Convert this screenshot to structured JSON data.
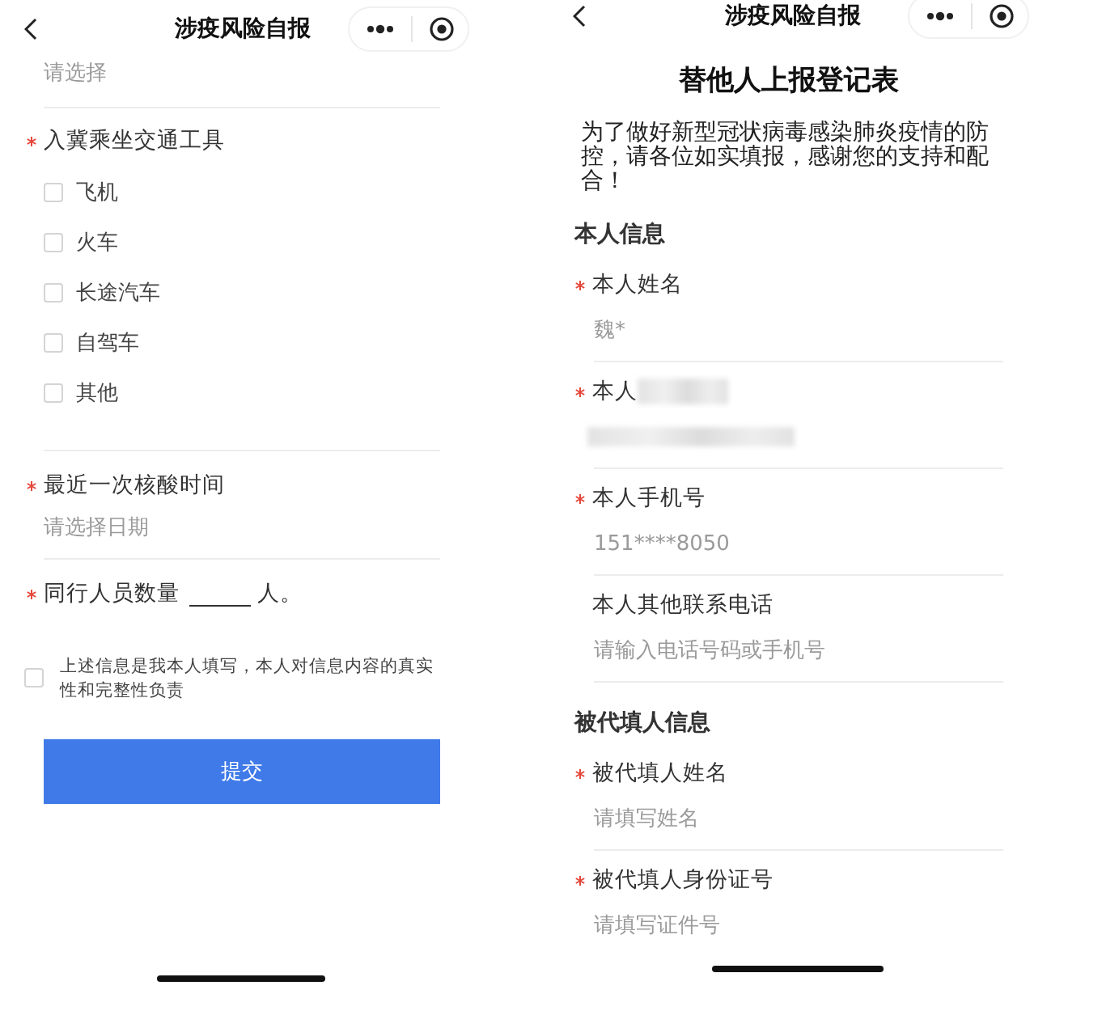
{
  "left_screen": {
    "nav": {
      "title": "涉疫风险自报"
    },
    "items": [
      {
        "kind": "select",
        "placeholder": "请选择"
      },
      {
        "kind": "checkbox_group",
        "label": "入冀乘坐交通工具",
        "required": true,
        "options": [
          {
            "label": "飞机",
            "checked": false
          },
          {
            "label": "火车",
            "checked": false
          },
          {
            "label": "长途汽车",
            "checked": false
          },
          {
            "label": "自驾车",
            "checked": false
          },
          {
            "label": "其他",
            "checked": false
          }
        ]
      },
      {
        "kind": "date",
        "label": "最近一次核酸时间",
        "required": true,
        "placeholder": "请选择日期"
      },
      {
        "kind": "inline_count",
        "label": "同行人员数量",
        "required": true,
        "unit": "人。"
      }
    ],
    "consent": {
      "text": "上述信息是我本人填写，本人对信息内容的真实性和完整性负责",
      "checked": false
    },
    "submit": "提交"
  },
  "right_screen": {
    "nav": {
      "title": "涉疫风险自报"
    },
    "form_title": "替他人上报登记表",
    "intro": "为了做好新型冠状病毒感染肺炎疫情的防控，请各位如实填报，感谢您的支持和配合！",
    "sections": [
      {
        "title": "本人信息",
        "fields": [
          {
            "label": "本人姓名",
            "required": true,
            "value": "魏*"
          },
          {
            "label": "本人",
            "required": true,
            "redacted": true
          },
          {
            "label": "本人手机号",
            "required": true,
            "value": "151****8050"
          },
          {
            "label": "本人其他联系电话",
            "required": false,
            "placeholder": "请输入电话号码或手机号"
          }
        ]
      },
      {
        "title": "被代填人信息",
        "fields": [
          {
            "label": "被代填人姓名",
            "required": true,
            "placeholder": "请填写姓名"
          },
          {
            "label": "被代填人身份证号",
            "required": true,
            "placeholder": "请填写证件号"
          }
        ]
      }
    ]
  }
}
